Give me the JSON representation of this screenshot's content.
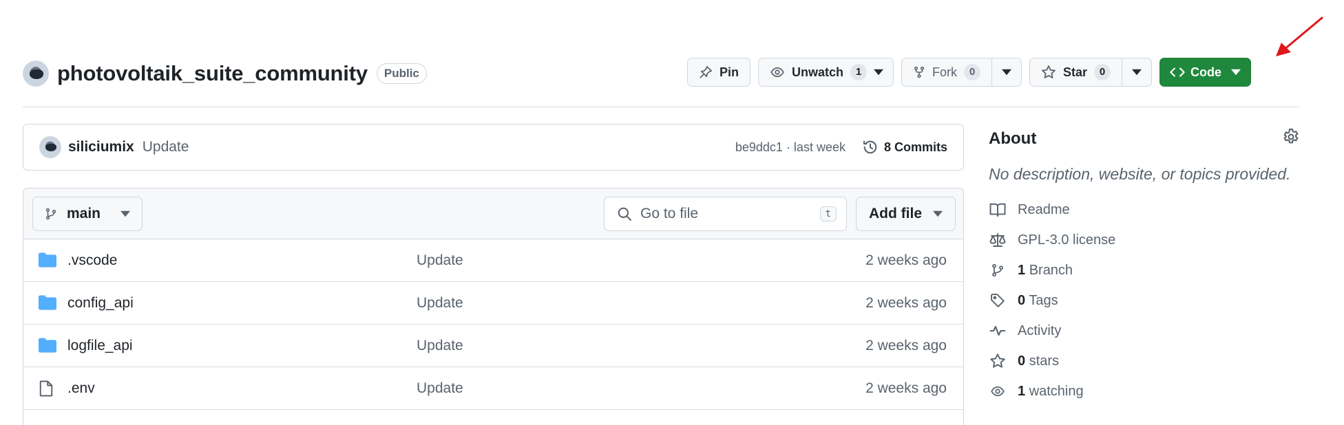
{
  "repo": {
    "name": "photovoltaik_suite_community",
    "visibility": "Public"
  },
  "actions": {
    "pin_label": "Pin",
    "unwatch_label": "Unwatch",
    "watch_count": "1",
    "fork_label": "Fork",
    "fork_count": "0",
    "star_label": "Star",
    "star_count": "0",
    "code_label": "Code",
    "code_color": "#1f883d"
  },
  "latest_commit": {
    "author": "siliciumix",
    "message": "Update",
    "meta": "be9ddc1 · last week",
    "commits_label": "8 Commits"
  },
  "file_browser": {
    "branch": "main",
    "search_placeholder": "Go to file",
    "search_shortcut": "t",
    "add_file_label": "Add file",
    "files": [
      {
        "name": ".vscode",
        "type": "folder",
        "message": "Update",
        "date": "2 weeks ago"
      },
      {
        "name": "config_api",
        "type": "folder",
        "message": "Update",
        "date": "2 weeks ago"
      },
      {
        "name": "logfile_api",
        "type": "folder",
        "message": "Update",
        "date": "2 weeks ago"
      },
      {
        "name": ".env",
        "type": "file",
        "message": "Update",
        "date": "2 weeks ago"
      }
    ]
  },
  "about": {
    "title": "About",
    "description": "No description, website, or topics provided.",
    "readme": "Readme",
    "license": "GPL-3.0 license",
    "branch_count": "1",
    "branch_label": "Branch",
    "tags_count": "0",
    "tags_label": "Tags",
    "activity": "Activity",
    "stars_count": "0",
    "stars_label": "stars",
    "watching_count": "1",
    "watching_label": "watching"
  },
  "annotation": {
    "arrow_color": "#e0161b"
  }
}
